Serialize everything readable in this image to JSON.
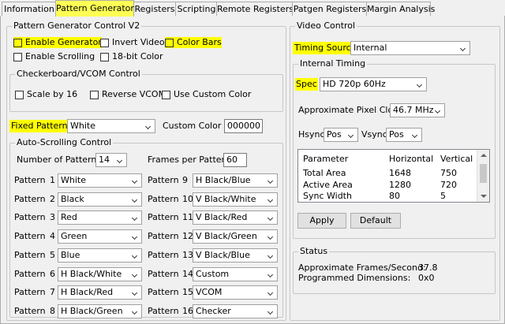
{
  "tabs": [
    "Information",
    "Pattern Generator",
    "Registers",
    "Scripting",
    "Remote Registers",
    "Patgen Registers",
    "Margin Analysis"
  ],
  "pattern_generator": {
    "title": "Pattern Generator Control V2",
    "enable_generator": "Enable Generator",
    "invert_video": "Invert Video",
    "color_bars": "Color Bars",
    "enable_scrolling": "Enable Scrolling",
    "bit18": "18-bit Color",
    "checkerboard": {
      "title": "Checkerboard/VCOM Control",
      "scale": "Scale by 16",
      "reverse": "Reverse VCOM",
      "custom": "Use Custom Color"
    },
    "fixed_pattern_label": "Fixed Pattern",
    "fixed_pattern_value": "White",
    "custom_color_label": "Custom Color #",
    "custom_color_value": "000000",
    "auto_scroll": {
      "title": "Auto-Scrolling Control",
      "num_patterns_label": "Number of Patterns",
      "num_patterns_value": "14",
      "frames_label": "Frames per Pattern",
      "frames_value": "60",
      "pattern_word": "Pattern",
      "left": [
        {
          "n": "1",
          "v": "White"
        },
        {
          "n": "2",
          "v": "Black"
        },
        {
          "n": "3",
          "v": "Red"
        },
        {
          "n": "4",
          "v": "Green"
        },
        {
          "n": "5",
          "v": "Blue"
        },
        {
          "n": "6",
          "v": "H Black/White"
        },
        {
          "n": "7",
          "v": "H Black/Red"
        },
        {
          "n": "8",
          "v": "H Black/Green"
        }
      ],
      "right": [
        {
          "n": "9",
          "v": "H Black/Blue"
        },
        {
          "n": "10",
          "v": "V Black/White"
        },
        {
          "n": "11",
          "v": "V Black/Red"
        },
        {
          "n": "12",
          "v": "V Black/Green"
        },
        {
          "n": "13",
          "v": "V Black/Blue"
        },
        {
          "n": "14",
          "v": "Custom"
        },
        {
          "n": "15",
          "v": "VCOM"
        },
        {
          "n": "16",
          "v": "Checker"
        }
      ]
    }
  },
  "video_control": {
    "title": "Video Control",
    "timing_source_label": "Timing Source",
    "timing_source_value": "Internal",
    "internal_timing": {
      "title": "Internal Timing",
      "spec_label": "Spec",
      "spec_value": "HD 720p 60Hz",
      "pixel_clock_label": "Approximate Pixel Clock",
      "pixel_clock_value": "46.7 MHz",
      "hsync_label": "Hsync",
      "hsync_value": "Pos",
      "vsync_label": "Vsync",
      "vsync_value": "Pos",
      "columns": [
        "Parameter",
        "Horizontal",
        "Vertical"
      ],
      "rows": [
        [
          "Total Area",
          "1648",
          "750"
        ],
        [
          "Active Area",
          "1280",
          "720"
        ],
        [
          "Sync Width",
          "80",
          "5"
        ]
      ],
      "apply": "Apply",
      "default": "Default"
    },
    "status": {
      "title": "Status",
      "fps_label": "Approximate Frames/Second:",
      "fps_value": "37.8",
      "dims_label": "Programmed Dimensions:",
      "dims_value": "0x0"
    }
  },
  "colors": {
    "highlight": "#ffff00",
    "active_tab": "#ffff55"
  }
}
